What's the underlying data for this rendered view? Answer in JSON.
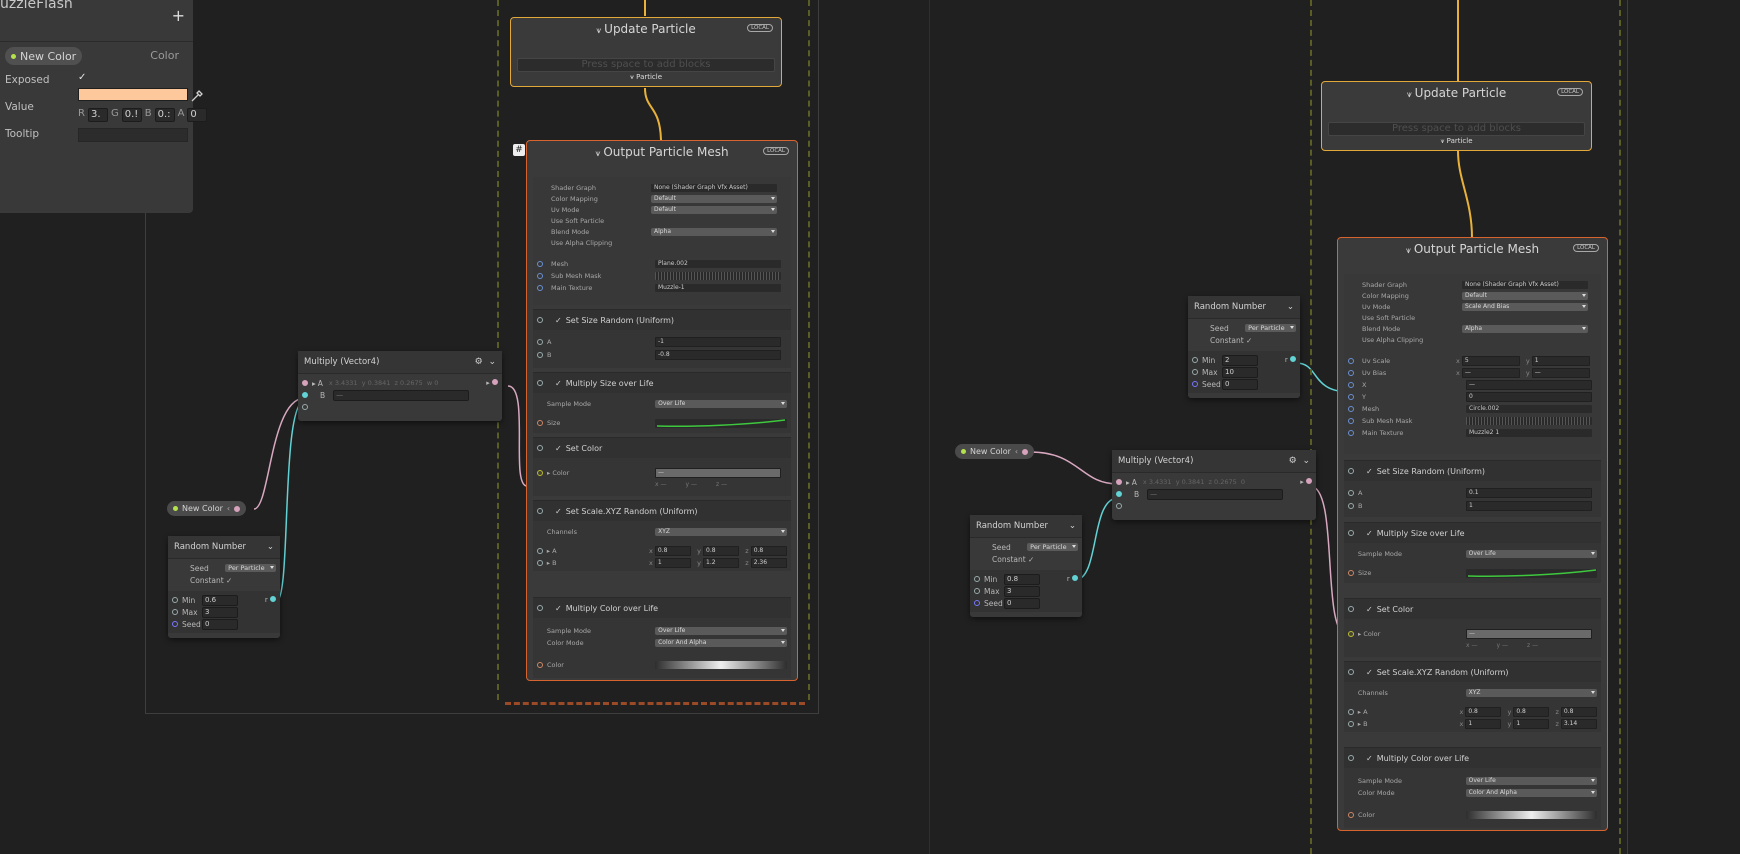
{
  "blackboard": {
    "title": "uzzleFlash",
    "add_label": "+",
    "property_name": "New Color",
    "property_type": "Color",
    "exposed_label": "Exposed",
    "exposed_check": "✓",
    "value_label": "Value",
    "value_color": "#fdc89b",
    "tooltip_label": "Tooltip",
    "r_label": "R",
    "r_val": "3.",
    "g_label": "G",
    "g_val": "0.!",
    "b_label": "B",
    "b_val": "0.:",
    "a_label": "A",
    "a_val": "0"
  },
  "left": {
    "update": {
      "title": "Update Particle",
      "badge": "LOCAL",
      "placeholder": "Press space to add blocks",
      "flow": "Particle"
    },
    "output": {
      "title": "Output Particle Mesh",
      "badge": "LOCAL",
      "settings": [
        {
          "label": "Shader Graph",
          "value": "None (Shader Graph Vfx Asset)"
        },
        {
          "label": "Color Mapping",
          "value": "Default"
        },
        {
          "label": "Uv Mode",
          "value": "Default"
        },
        {
          "label": "Use Soft Particle",
          "value": ""
        },
        {
          "label": "Blend Mode",
          "value": "Alpha"
        },
        {
          "label": "Use Alpha Clipping",
          "value": ""
        }
      ],
      "mesh_label": "Mesh",
      "mesh_value": "Plane.002",
      "submesh_label": "Sub Mesh Mask",
      "maintex_label": "Main Texture",
      "maintex_value": "Muzzle-1",
      "size_random": {
        "title": "Set Size Random (Uniform)",
        "a_label": "A",
        "a": "-1",
        "b_label": "B",
        "b": "-0.8"
      },
      "size_life": {
        "title": "Multiply Size over Life",
        "mode_label": "Sample Mode",
        "mode": "Over Life",
        "size_label": "Size"
      },
      "set_color": {
        "title": "Set Color",
        "color_label": "Color",
        "value": "—",
        "x": "—",
        "y": "—",
        "z": "—"
      },
      "scale_xyz": {
        "title": "Set Scale.XYZ Random (Uniform)",
        "channels_label": "Channels",
        "channels": "XYZ",
        "a_label": "A",
        "ax": "0.8",
        "ay": "0.8",
        "az": "0.8",
        "b_label": "B",
        "bx": "1",
        "by": "1.2",
        "bz": "2.36"
      },
      "color_life": {
        "title": "Multiply Color over Life",
        "mode_label": "Sample Mode",
        "mode": "Over Life",
        "cmode_label": "Color Mode",
        "cmode": "Color And Alpha",
        "color_label": "Color"
      }
    },
    "multiply": {
      "title": "Multiply (Vector4)",
      "a_label": "A",
      "ax": "3.4331",
      "ay": "0.3841",
      "az": "0.2675",
      "aw": "0",
      "b_label": "B",
      "b_val": "—"
    },
    "new_color": {
      "label": "New Color"
    },
    "random": {
      "title": "Random Number",
      "seed_label": "Seed",
      "seed_mode": "Per Particle",
      "constant_label": "Constant",
      "constant_check": "✓",
      "min_label": "Min",
      "min": "0.6",
      "max_label": "Max",
      "max": "3",
      "seed2_label": "Seed",
      "seed": "0",
      "out": "r"
    }
  },
  "right": {
    "update": {
      "title": "Update Particle",
      "badge": "LOCAL",
      "placeholder": "Press space to add blocks",
      "flow": "Particle"
    },
    "output": {
      "title": "Output Particle Mesh",
      "badge": "LOCAL",
      "settings": [
        {
          "label": "Shader Graph",
          "value": "None (Shader Graph Vfx Asset)"
        },
        {
          "label": "Color Mapping",
          "value": "Default"
        },
        {
          "label": "Uv Mode",
          "value": "Scale And Bias"
        },
        {
          "label": "Use Soft Particle",
          "value": ""
        },
        {
          "label": "Blend Mode",
          "value": "Alpha"
        },
        {
          "label": "Use Alpha Clipping",
          "value": ""
        }
      ],
      "uvscale_label": "Uv Scale",
      "uvscale_x": "5",
      "uvscale_y": "1",
      "uvbias_label": "Uv Bias",
      "uvbias_x": "—",
      "uvbias_y": "—",
      "x_label": "X",
      "x_val": "—",
      "y_label": "Y",
      "y_val": "0",
      "mesh_label": "Mesh",
      "mesh_value": "Circle.002",
      "submesh_label": "Sub Mesh Mask",
      "maintex_label": "Main Texture",
      "maintex_value": "Muzzle2 1",
      "size_random": {
        "title": "Set Size Random (Uniform)",
        "a_label": "A",
        "a": "0.1",
        "b_label": "B",
        "b": "1"
      },
      "size_life": {
        "title": "Multiply Size over Life",
        "mode_label": "Sample Mode",
        "mode": "Over Life",
        "size_label": "Size"
      },
      "set_color": {
        "title": "Set Color",
        "color_label": "Color",
        "value": "—",
        "x": "—",
        "y": "—",
        "z": "—"
      },
      "scale_xyz": {
        "title": "Set Scale.XYZ Random (Uniform)",
        "channels_label": "Channels",
        "channels": "XYZ",
        "a_label": "A",
        "ax": "0.8",
        "ay": "0.8",
        "az": "0.8",
        "b_label": "B",
        "bx": "1",
        "by": "1",
        "bz": "3.14"
      },
      "color_life": {
        "title": "Multiply Color over Life",
        "mode_label": "Sample Mode",
        "mode": "Over Life",
        "cmode_label": "Color Mode",
        "cmode": "Color And Alpha",
        "color_label": "Color"
      }
    },
    "random_top": {
      "title": "Random Number",
      "seed_label": "Seed",
      "seed_mode": "Per Particle",
      "constant_label": "Constant",
      "constant_check": "✓",
      "min_label": "Min",
      "min": "2",
      "max_label": "Max",
      "max": "10",
      "seed2_label": "Seed",
      "seed": "0",
      "out": "r"
    },
    "new_color": {
      "label": "New Color"
    },
    "multiply": {
      "title": "Multiply (Vector4)",
      "a_label": "A",
      "ax": "3.4331",
      "ay": "0.3841",
      "az": "0.2675",
      "aw": "0",
      "b_label": "B",
      "b_val": "—"
    },
    "random_bot": {
      "title": "Random Number",
      "seed_label": "Seed",
      "seed_mode": "Per Particle",
      "constant_label": "Constant",
      "constant_check": "✓",
      "min_label": "Min",
      "min": "0.8",
      "max_label": "Max",
      "max": "3",
      "seed2_label": "Seed",
      "seed": "0",
      "out": "r"
    }
  },
  "axis_labels": {
    "x": "x",
    "y": "y",
    "z": "z"
  }
}
